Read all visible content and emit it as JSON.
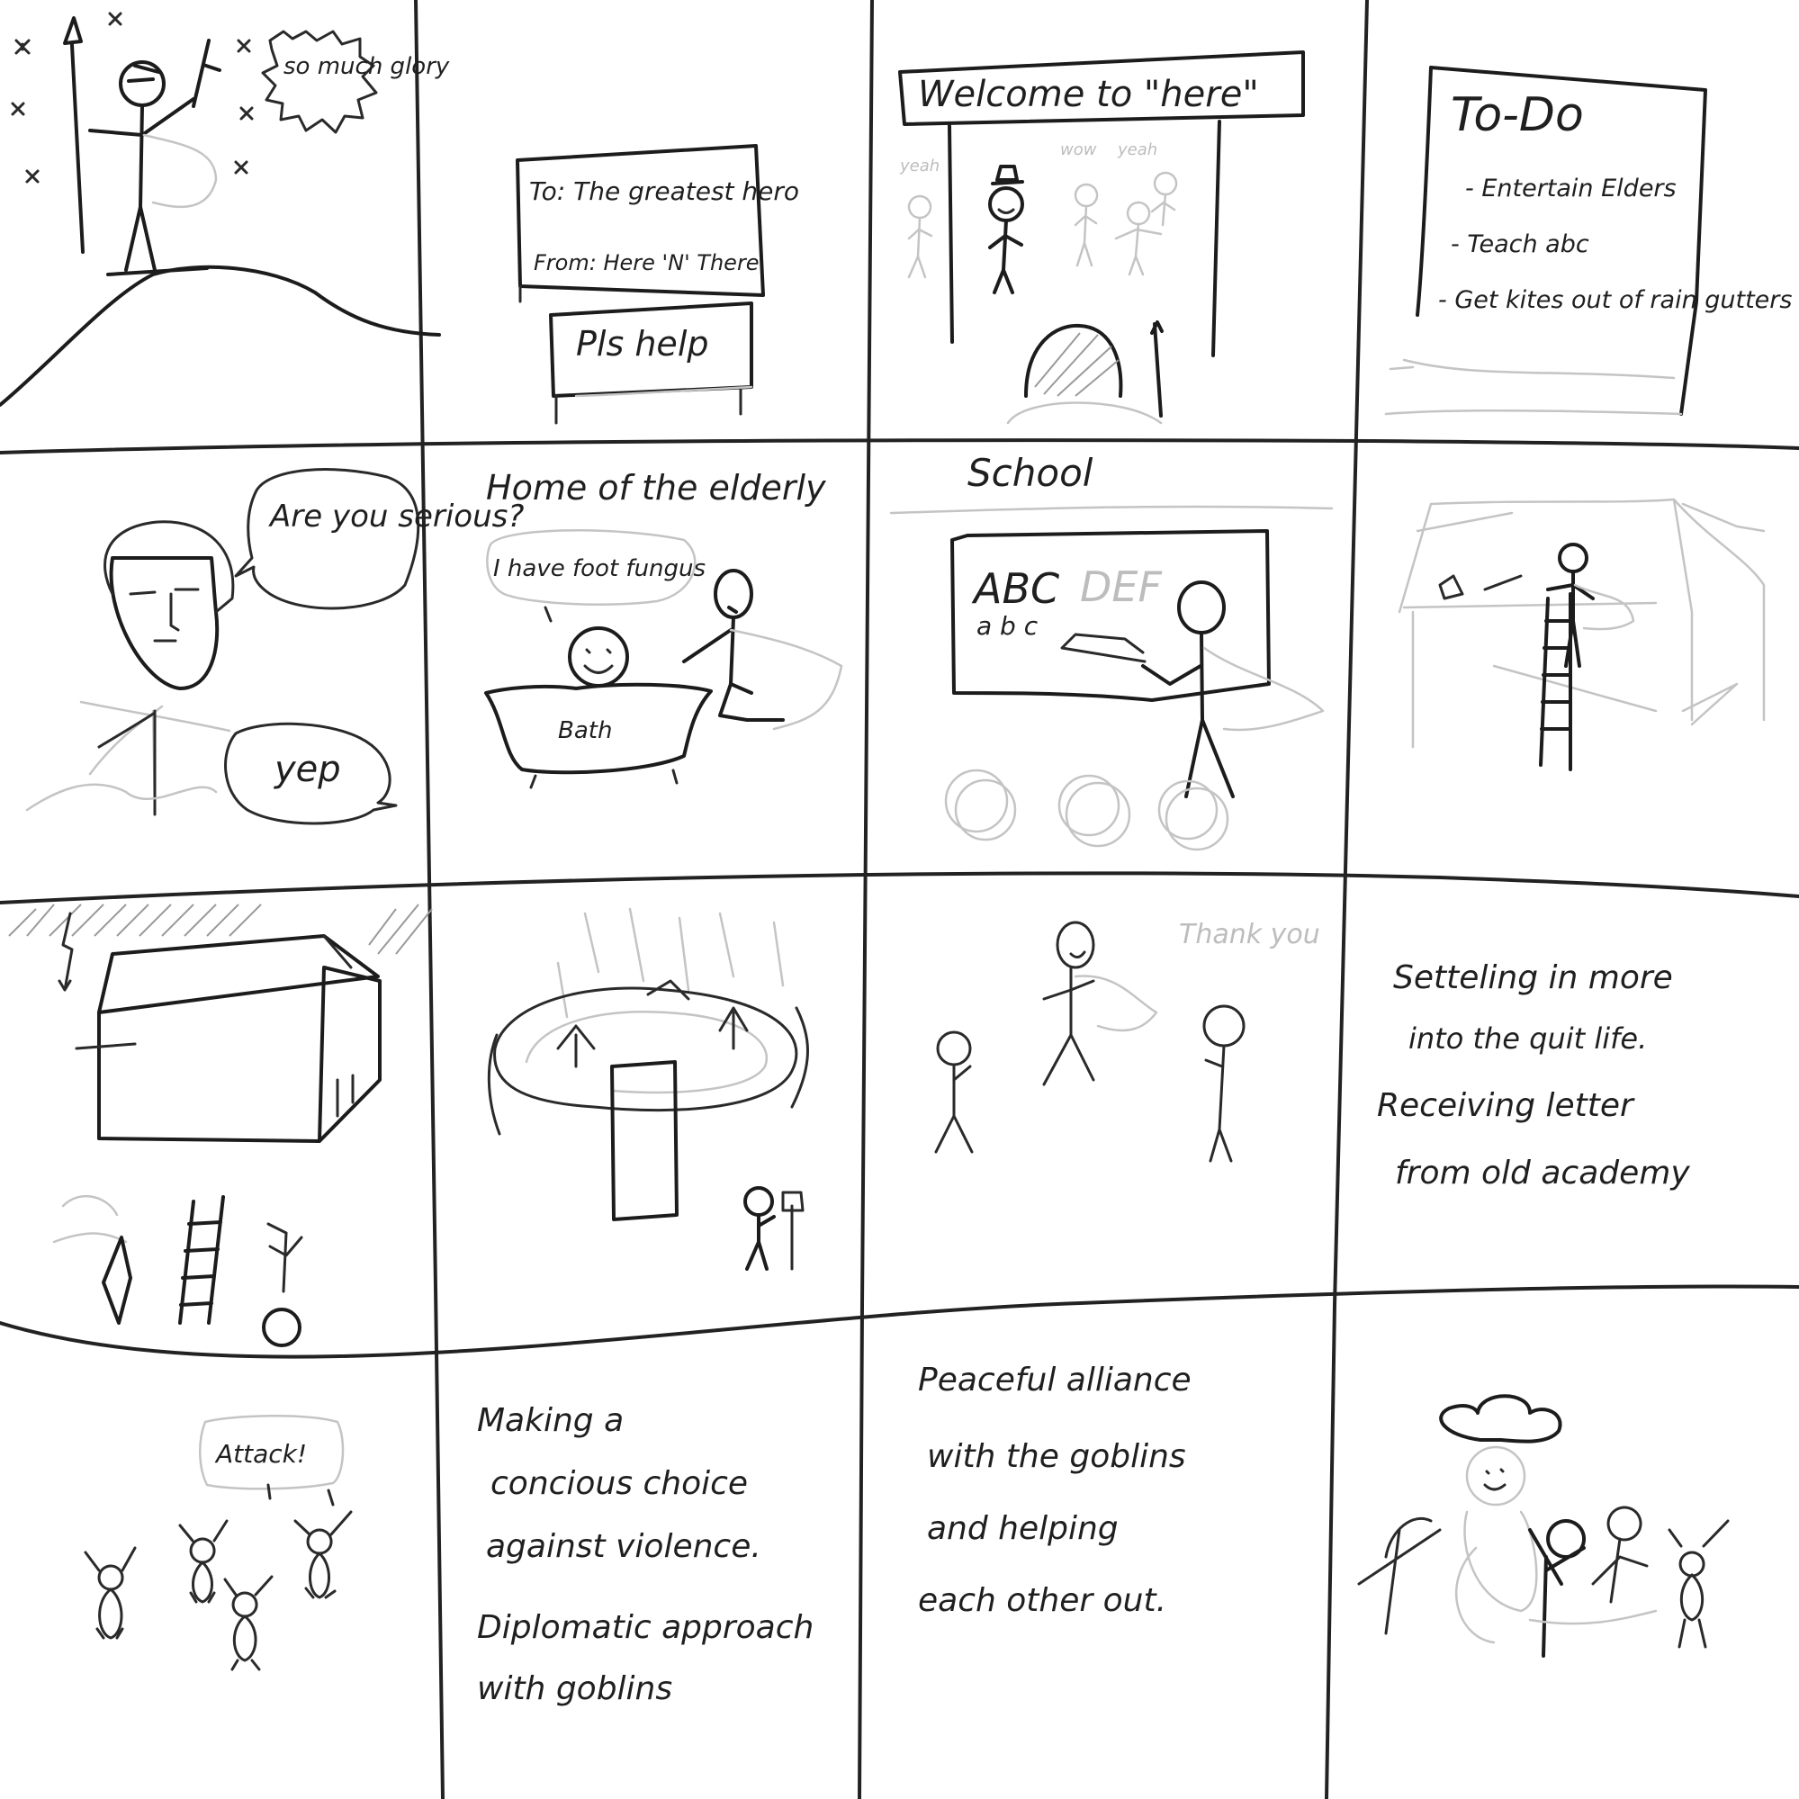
{
  "panels": {
    "p1": {
      "bubble": "so much glory"
    },
    "p2": {
      "letter_to": "To: The greatest hero",
      "letter_from": "From: Here 'N' There",
      "sign": "Pls help"
    },
    "p3": {
      "banner": "Welcome to \"here\"",
      "crowd_1": "yeah",
      "crowd_2": "wow",
      "crowd_3": "yeah"
    },
    "p4": {
      "title": "To-Do",
      "items": [
        "- Entertain Elders",
        "- Teach abc",
        "- Get kites out of rain gutters"
      ]
    },
    "p5": {
      "question": "Are you serious?",
      "answer": "yep"
    },
    "p6": {
      "caption": "Home of the elderly",
      "speech": "I have foot fungus",
      "tub": "Bath"
    },
    "p7": {
      "caption": "School",
      "board_upper": "ABC",
      "board_upper_faint": "DEF",
      "board_lower": "a b c"
    },
    "p11": {
      "speech": "Thank you"
    },
    "p12": {
      "lines": [
        "Setteling in more",
        "into the quit life.",
        "Receiving letter",
        "from old academy"
      ]
    },
    "p13": {
      "speech": "Attack!"
    },
    "p14": {
      "lines": [
        "Making a",
        "concious choice",
        "against violence.",
        "Diplomatic approach",
        "with goblins"
      ]
    },
    "p15": {
      "lines": [
        "Peaceful alliance",
        "with the goblins",
        "and helping",
        "each other out."
      ]
    }
  }
}
